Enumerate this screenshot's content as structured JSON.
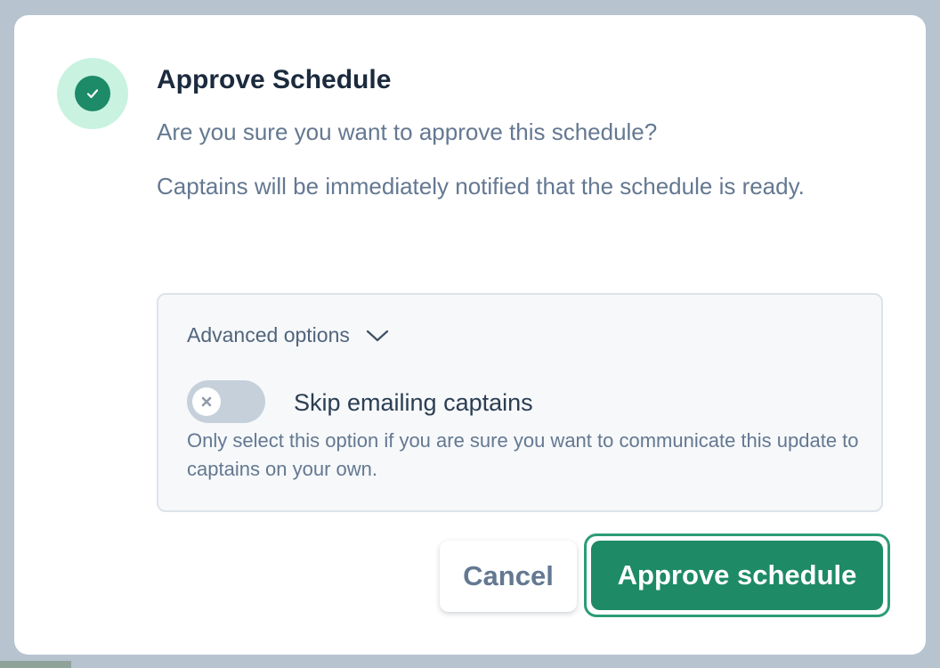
{
  "dialog": {
    "title": "Approve Schedule",
    "question": "Are you sure you want to approve this schedule?",
    "description": "Captains will be immediately notified that the schedule is ready.",
    "status_icon": "check-icon",
    "status_color": "#1d8a68"
  },
  "advanced": {
    "label": "Advanced options",
    "chevron_icon": "chevron-down-icon",
    "skip_toggle": {
      "label": "Skip emailing captains",
      "help": "Only select this option if you are sure you want to communicate this update to captains on your own.",
      "checked": false,
      "off_icon": "x-icon"
    }
  },
  "actions": {
    "cancel_label": "Cancel",
    "approve_label": "Approve schedule",
    "approve_color": "#1e8a66"
  }
}
